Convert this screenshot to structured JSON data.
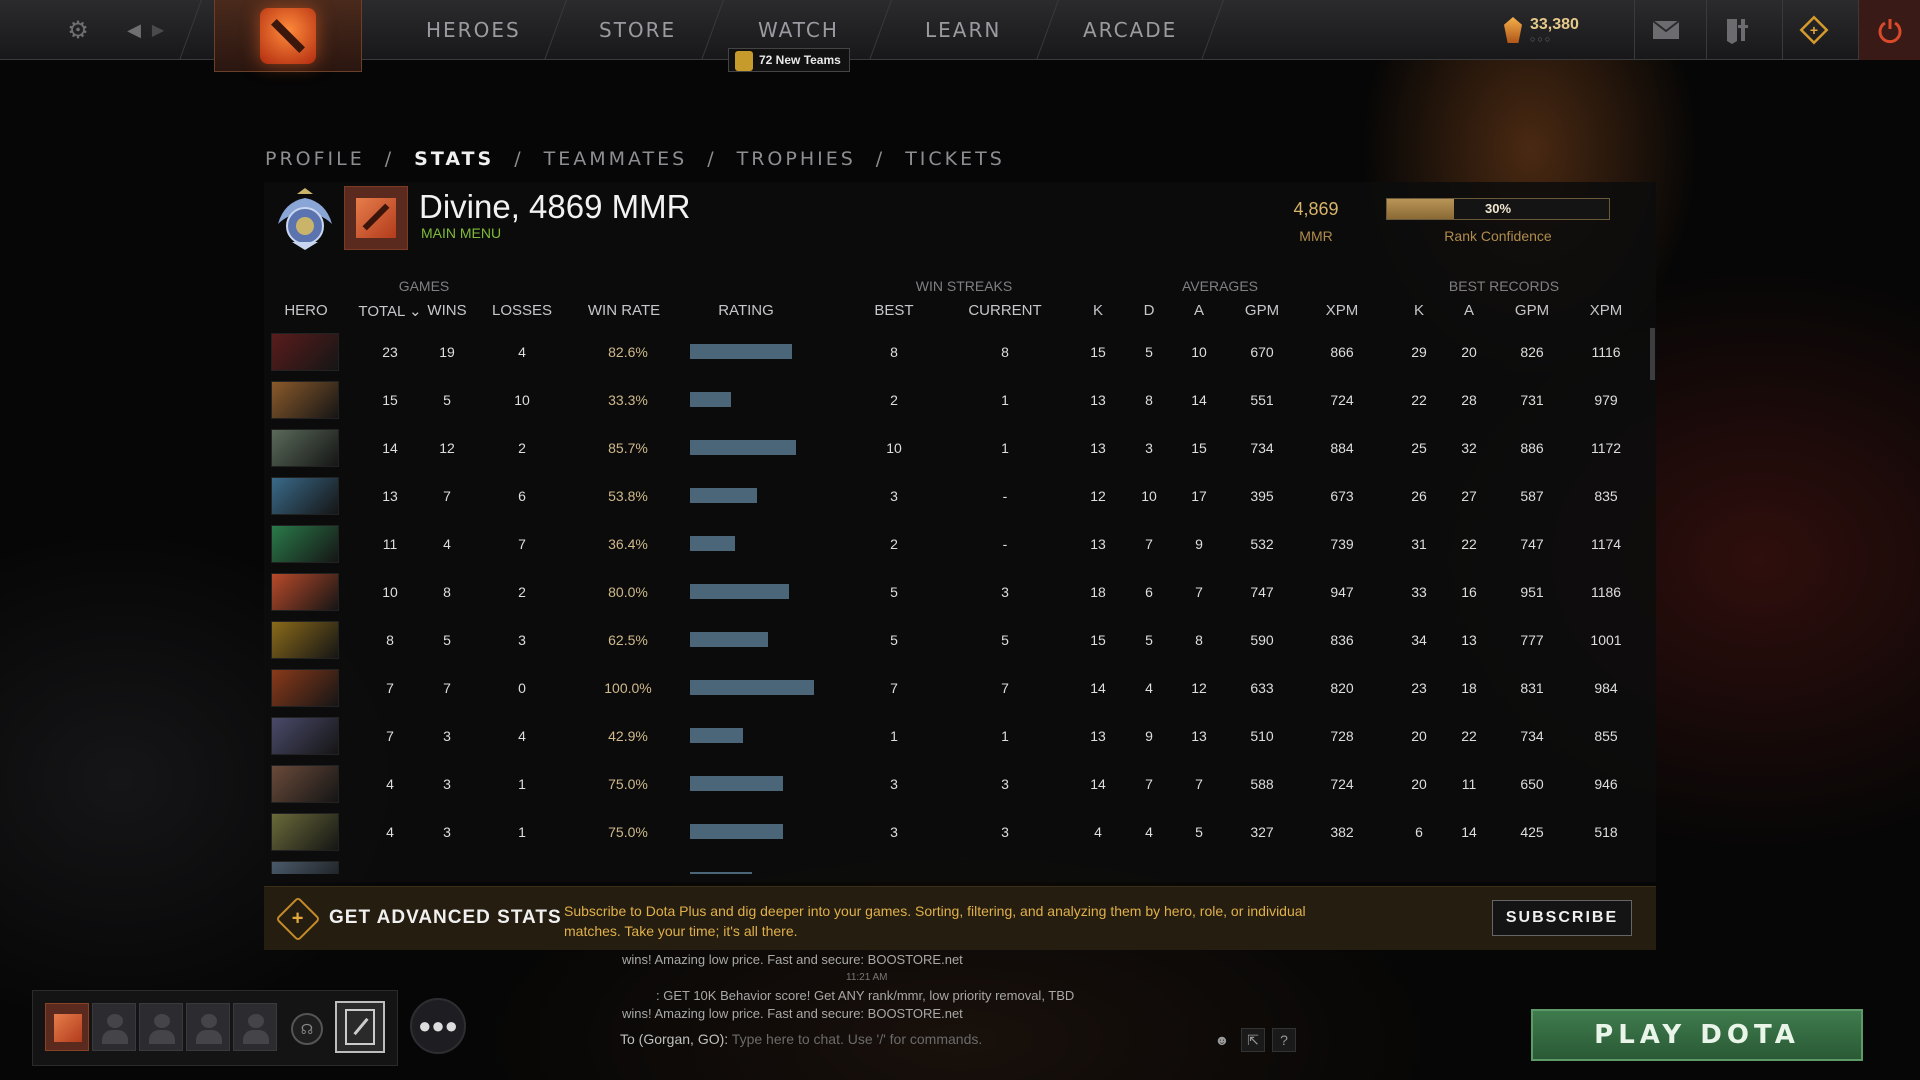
{
  "topbar": {
    "nav": [
      "HEROES",
      "STORE",
      "WATCH",
      "LEARN",
      "ARCADE"
    ],
    "new_teams": "72 New Teams",
    "shards": "33,380"
  },
  "breadcrumb": [
    "PROFILE",
    "/",
    "STATS",
    "/",
    "TEAMMATES",
    "/",
    "TROPHIES",
    "/",
    "TICKETS"
  ],
  "profile": {
    "title": "Divine, 4869 MMR",
    "subtitle": "MAIN MENU",
    "mmr_value": "4,869",
    "mmr_label": "MMR",
    "confidence_pct": "30%",
    "confidence_fraction": 0.3,
    "confidence_label": "Rank Confidence"
  },
  "table": {
    "groups": {
      "games": "GAMES",
      "win_streaks": "WIN STREAKS",
      "averages": "AVERAGES",
      "best_records": "BEST RECORDS"
    },
    "columns": {
      "hero": "HERO",
      "total": "TOTAL ⌄",
      "wins": "WINS",
      "losses": "LOSSES",
      "win_rate": "WIN RATE",
      "rating": "RATING",
      "best": "BEST",
      "current": "CURRENT",
      "k": "K",
      "d": "D",
      "a": "A",
      "gpm": "GPM",
      "xpm": "XPM",
      "best_k": "K",
      "best_a": "A",
      "best_gpm": "GPM",
      "best_xpm": "XPM"
    },
    "rows": [
      {
        "portrait": "#5a1c1c",
        "total": "23",
        "wins": "19",
        "losses": "4",
        "win_rate": "82.6%",
        "rating": 0.826,
        "best": "8",
        "current": "8",
        "k": "15",
        "d": "5",
        "a": "10",
        "gpm": "670",
        "xpm": "866",
        "bk": "29",
        "ba": "20",
        "bgpm": "826",
        "bxpm": "1116"
      },
      {
        "portrait": "#8a5a2a",
        "total": "15",
        "wins": "5",
        "losses": "10",
        "win_rate": "33.3%",
        "rating": 0.333,
        "best": "2",
        "current": "1",
        "k": "13",
        "d": "8",
        "a": "14",
        "gpm": "551",
        "xpm": "724",
        "bk": "22",
        "ba": "28",
        "bgpm": "731",
        "bxpm": "979"
      },
      {
        "portrait": "#5a6a5a",
        "total": "14",
        "wins": "12",
        "losses": "2",
        "win_rate": "85.7%",
        "rating": 0.857,
        "best": "10",
        "current": "1",
        "k": "13",
        "d": "3",
        "a": "15",
        "gpm": "734",
        "xpm": "884",
        "bk": "25",
        "ba": "32",
        "bgpm": "886",
        "bxpm": "1172"
      },
      {
        "portrait": "#3a6a8a",
        "total": "13",
        "wins": "7",
        "losses": "6",
        "win_rate": "53.8%",
        "rating": 0.538,
        "best": "3",
        "current": "-",
        "k": "12",
        "d": "10",
        "a": "17",
        "gpm": "395",
        "xpm": "673",
        "bk": "26",
        "ba": "27",
        "bgpm": "587",
        "bxpm": "835"
      },
      {
        "portrait": "#2a7a4a",
        "total": "11",
        "wins": "4",
        "losses": "7",
        "win_rate": "36.4%",
        "rating": 0.364,
        "best": "2",
        "current": "-",
        "k": "13",
        "d": "7",
        "a": "9",
        "gpm": "532",
        "xpm": "739",
        "bk": "31",
        "ba": "22",
        "bgpm": "747",
        "bxpm": "1174"
      },
      {
        "portrait": "#b84a2a",
        "total": "10",
        "wins": "8",
        "losses": "2",
        "win_rate": "80.0%",
        "rating": 0.8,
        "best": "5",
        "current": "3",
        "k": "18",
        "d": "6",
        "a": "7",
        "gpm": "747",
        "xpm": "947",
        "bk": "33",
        "ba": "16",
        "bgpm": "951",
        "bxpm": "1186"
      },
      {
        "portrait": "#8a6a1a",
        "total": "8",
        "wins": "5",
        "losses": "3",
        "win_rate": "62.5%",
        "rating": 0.625,
        "best": "5",
        "current": "5",
        "k": "15",
        "d": "5",
        "a": "8",
        "gpm": "590",
        "xpm": "836",
        "bk": "34",
        "ba": "13",
        "bgpm": "777",
        "bxpm": "1001"
      },
      {
        "portrait": "#8a3a1a",
        "total": "7",
        "wins": "7",
        "losses": "0",
        "win_rate": "100.0%",
        "rating": 1.0,
        "best": "7",
        "current": "7",
        "k": "14",
        "d": "4",
        "a": "12",
        "gpm": "633",
        "xpm": "820",
        "bk": "23",
        "ba": "18",
        "bgpm": "831",
        "bxpm": "984"
      },
      {
        "portrait": "#4a4a6a",
        "total": "7",
        "wins": "3",
        "losses": "4",
        "win_rate": "42.9%",
        "rating": 0.429,
        "best": "1",
        "current": "1",
        "k": "13",
        "d": "9",
        "a": "13",
        "gpm": "510",
        "xpm": "728",
        "bk": "20",
        "ba": "22",
        "bgpm": "734",
        "bxpm": "855"
      },
      {
        "portrait": "#6a4a3a",
        "total": "4",
        "wins": "3",
        "losses": "1",
        "win_rate": "75.0%",
        "rating": 0.75,
        "best": "3",
        "current": "3",
        "k": "14",
        "d": "7",
        "a": "7",
        "gpm": "588",
        "xpm": "724",
        "bk": "20",
        "ba": "11",
        "bgpm": "650",
        "bxpm": "946"
      },
      {
        "portrait": "#6a6a3a",
        "total": "4",
        "wins": "3",
        "losses": "1",
        "win_rate": "75.0%",
        "rating": 0.75,
        "best": "3",
        "current": "3",
        "k": "4",
        "d": "4",
        "a": "5",
        "gpm": "327",
        "xpm": "382",
        "bk": "6",
        "ba": "14",
        "bgpm": "425",
        "bxpm": "518"
      },
      {
        "portrait": "#4a5a6a",
        "total": "",
        "wins": "",
        "losses": "",
        "win_rate": "",
        "rating": 0.5,
        "best": "",
        "current": "",
        "k": "",
        "d": "",
        "a": "",
        "gpm": "",
        "xpm": "",
        "bk": "",
        "ba": "",
        "bgpm": "",
        "bxpm": ""
      }
    ]
  },
  "advanced": {
    "heading": "GET ADVANCED STATS",
    "text": "Subscribe to Dota Plus and dig deeper into your games. Sorting, filtering, and analyzing them by hero, role, or individual matches. Take your time; it's all there.",
    "button": "SUBSCRIBE"
  },
  "chat": {
    "line1": "wins! Amazing low price. Fast and secure: BOOSTORE.net",
    "time": "11:21 AM",
    "line2": ": GET 10K Behavior score! Get ANY rank/mmr, low priority removal, TBD",
    "line3": "wins! Amazing low price. Fast and secure: BOOSTORE.net",
    "target": "To (Gorgan, GO):",
    "placeholder": "Type here to chat. Use '/' for commands."
  },
  "play_button": "PLAY DOTA",
  "icons": [
    "gear-icon",
    "back-arrow-icon",
    "forward-arrow-icon",
    "dota-logo-icon",
    "shard-icon",
    "mail-icon",
    "armory-icon",
    "dota-plus-icon",
    "power-icon",
    "new-teams-icon",
    "rank-medal-icon",
    "headset-icon",
    "invite-icon",
    "friends-icon",
    "emoji-icon",
    "chat-expand-icon",
    "help-icon"
  ]
}
